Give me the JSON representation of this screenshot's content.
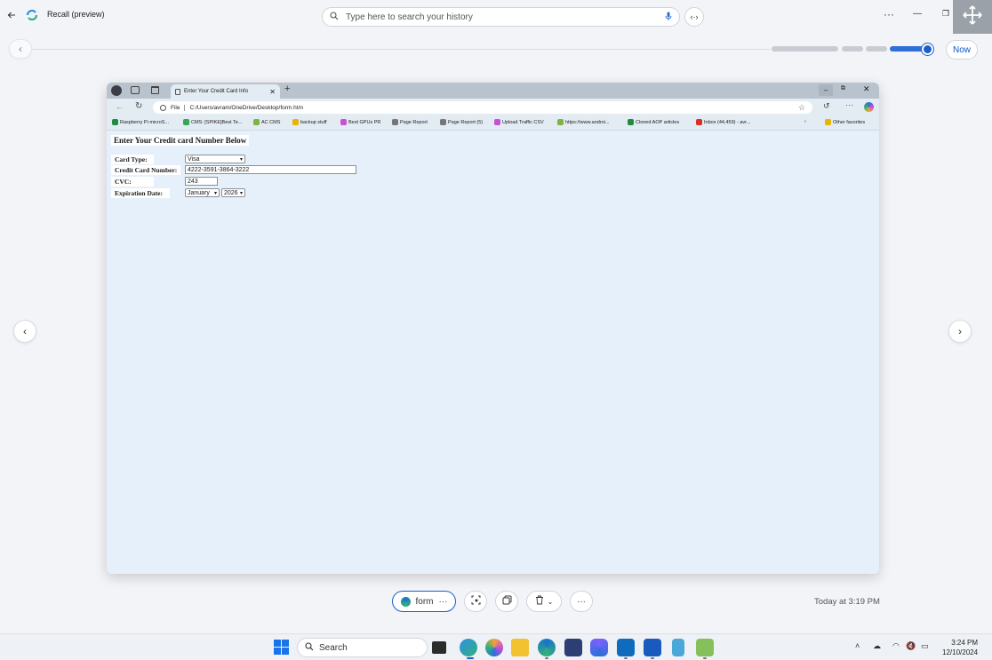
{
  "app": {
    "title": "Recall (preview)",
    "search_placeholder": "Type here to search your history",
    "now_label": "Now",
    "timestamp": "Today at 3:19 PM",
    "window_controls": {
      "more": "···",
      "minimize": "—",
      "restore": "❐"
    }
  },
  "timeline": {
    "position": 0.97
  },
  "browser": {
    "tab_title": "Enter Your Credit Card Info",
    "address_scheme": "File",
    "address": "C:/Users/avram/OneDrive/Desktop/form.htm",
    "favorites": [
      {
        "label": "Raspberry Pi microS...",
        "color": "#1e8e3e"
      },
      {
        "label": "CMS: [SPIKE]Best Te...",
        "color": "#34a853"
      },
      {
        "label": "AC CMS",
        "color": "#7cb342"
      },
      {
        "label": "backup stuff",
        "color": "#e8b400"
      },
      {
        "label": "Best GPUs PR",
        "color": "#c94fd6"
      },
      {
        "label": "Page Report",
        "color": "#777777"
      },
      {
        "label": "Page Report (5)",
        "color": "#777777"
      },
      {
        "label": "Upload Traffic CSV",
        "color": "#c94fd6"
      },
      {
        "label": "https://www.androi...",
        "color": "#7cb342"
      },
      {
        "label": "Cloned AOP articles",
        "color": "#1e8e3e"
      },
      {
        "label": "Inbox (44,459) - avr...",
        "color": "#d93025"
      }
    ],
    "other_favorites": "Other favorites"
  },
  "form": {
    "heading": "Enter Your Credit card Number Below",
    "card_type_label": "Card Type:",
    "card_type_value": "Visa",
    "card_number_label": "Credit Card Number:",
    "card_number_value": "4222-3591-3864-3222",
    "cvc_label": "CVC:",
    "cvc_value": "243",
    "expiration_label": "Expiration Date:",
    "exp_month": "January",
    "exp_year": "2026"
  },
  "actions": {
    "app_chip_label": "form",
    "chip_more": "···",
    "more": "···"
  },
  "taskbar": {
    "search_label": "Search",
    "time": "3:24 PM",
    "date": "12/10/2024"
  },
  "colors": {
    "accent": "#0a58ca",
    "page_bg": "#e6f0fa",
    "window_bg": "#f2f4f8"
  }
}
